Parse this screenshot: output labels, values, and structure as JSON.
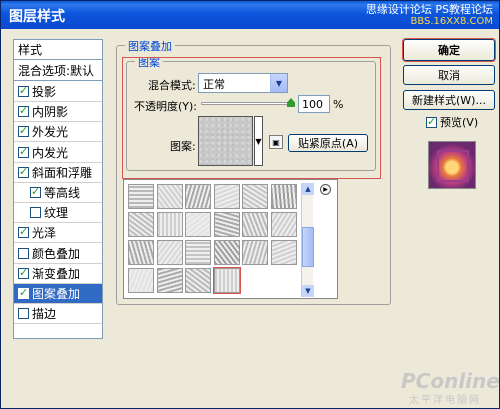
{
  "window": {
    "title": "图层样式"
  },
  "watermark": {
    "line1": "思缘设计论坛",
    "line2": "PS教程论坛",
    "line3": "BBS.16XX8.COM"
  },
  "styles_panel": {
    "header": "样式",
    "blend_options": "混合选项:默认",
    "items": [
      {
        "label": "投影",
        "checked": true
      },
      {
        "label": "内阴影",
        "checked": true
      },
      {
        "label": "外发光",
        "checked": true
      },
      {
        "label": "内发光",
        "checked": true
      },
      {
        "label": "斜面和浮雕",
        "checked": true
      },
      {
        "label": "等高线",
        "checked": true
      },
      {
        "label": "纹理",
        "checked": false
      },
      {
        "label": "光泽",
        "checked": true
      },
      {
        "label": "颜色叠加",
        "checked": false
      },
      {
        "label": "渐变叠加",
        "checked": true
      },
      {
        "label": "图案叠加",
        "checked": true,
        "selected": true
      },
      {
        "label": "描边",
        "checked": false
      }
    ]
  },
  "pattern_overlay": {
    "group_title": "图案叠加",
    "subgroup_title": "图案",
    "blend_mode_label": "混合模式:",
    "blend_mode_value": "正常",
    "opacity_label": "不透明度(Y):",
    "opacity_value": "100",
    "opacity_unit": "%",
    "opacity_fraction": 1.0,
    "pattern_label": "图案:",
    "snap_button": "贴紧原点(A)"
  },
  "buttons": {
    "ok": "确定",
    "cancel": "取消",
    "new_style": "新建样式(W)...",
    "preview_label": "预览(V)",
    "preview_checked": true
  },
  "branding": {
    "name": "PConline",
    "sub": "太平洋电脑网"
  },
  "colors": {
    "title_bar": "#0a58d8",
    "selection": "#316ac5",
    "highlight": "#d9534f"
  }
}
